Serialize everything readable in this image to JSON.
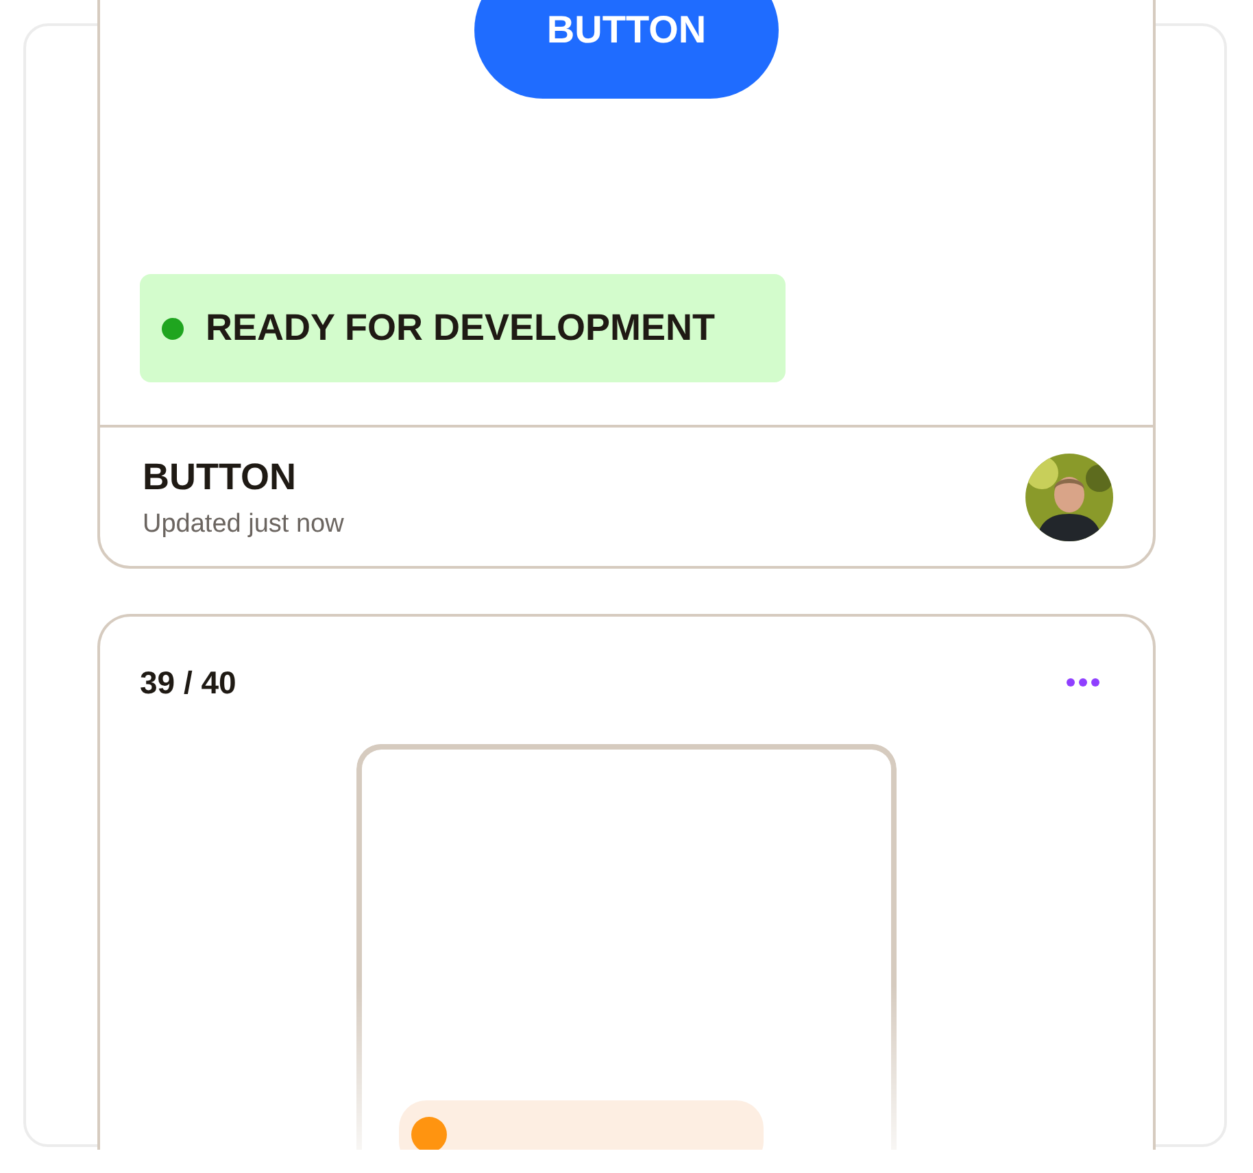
{
  "top_card": {
    "button": {
      "label": "BUTTON"
    },
    "status": {
      "label": "READY FOR DEVELOPMENT"
    },
    "footer": {
      "title": "BUTTON",
      "subtitle": "Updated just now"
    }
  },
  "bottom_card": {
    "counter": "39 / 40"
  }
}
